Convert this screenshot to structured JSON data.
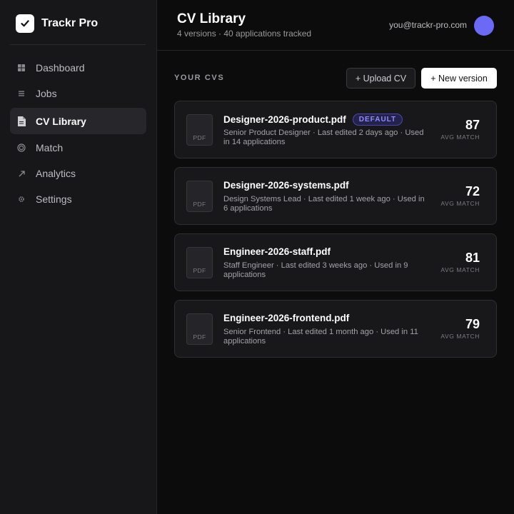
{
  "brand": {
    "name": "Trackr Pro",
    "logo_icon": "check-icon"
  },
  "sidebar": {
    "items": [
      {
        "label": "Dashboard",
        "icon": "grid-icon",
        "active": false
      },
      {
        "label": "Jobs",
        "icon": "list-icon",
        "active": false
      },
      {
        "label": "CV Library",
        "icon": "document-icon",
        "active": true
      },
      {
        "label": "Match",
        "icon": "target-icon",
        "active": false
      },
      {
        "label": "Analytics",
        "icon": "trend-arrow-icon",
        "active": false
      },
      {
        "label": "Settings",
        "icon": "gear-icon",
        "active": false
      }
    ]
  },
  "header": {
    "title": "CV Library",
    "subtitle": "4 versions · 40 applications tracked",
    "user_email": "you@trackr-pro.com"
  },
  "main": {
    "section_label": "YOUR CVS",
    "upload_label": "+ Upload CV",
    "new_version_label": "+ New version",
    "score_label": "AVG MATCH",
    "file_ext": "PDF",
    "cvs": [
      {
        "name": "Designer-2026-product.pdf",
        "badge": "DEFAULT",
        "meta": "Senior Product Designer · Last edited 2 days ago · Used in 14 applications",
        "score": "87"
      },
      {
        "name": "Designer-2026-systems.pdf",
        "badge": "",
        "meta": "Design Systems Lead · Last edited 1 week ago · Used in 6 applications",
        "score": "72"
      },
      {
        "name": "Engineer-2026-staff.pdf",
        "badge": "",
        "meta": "Staff Engineer · Last edited 3 weeks ago · Used in 9 applications",
        "score": "81"
      },
      {
        "name": "Engineer-2026-frontend.pdf",
        "badge": "",
        "meta": "Senior Frontend · Last edited 1 month ago · Used in 11 applications",
        "score": "79"
      }
    ]
  },
  "colors": {
    "accent": "#6b6af5",
    "background": "#0c0c0d",
    "sidebar": "#17171a",
    "card": "#18181b"
  }
}
